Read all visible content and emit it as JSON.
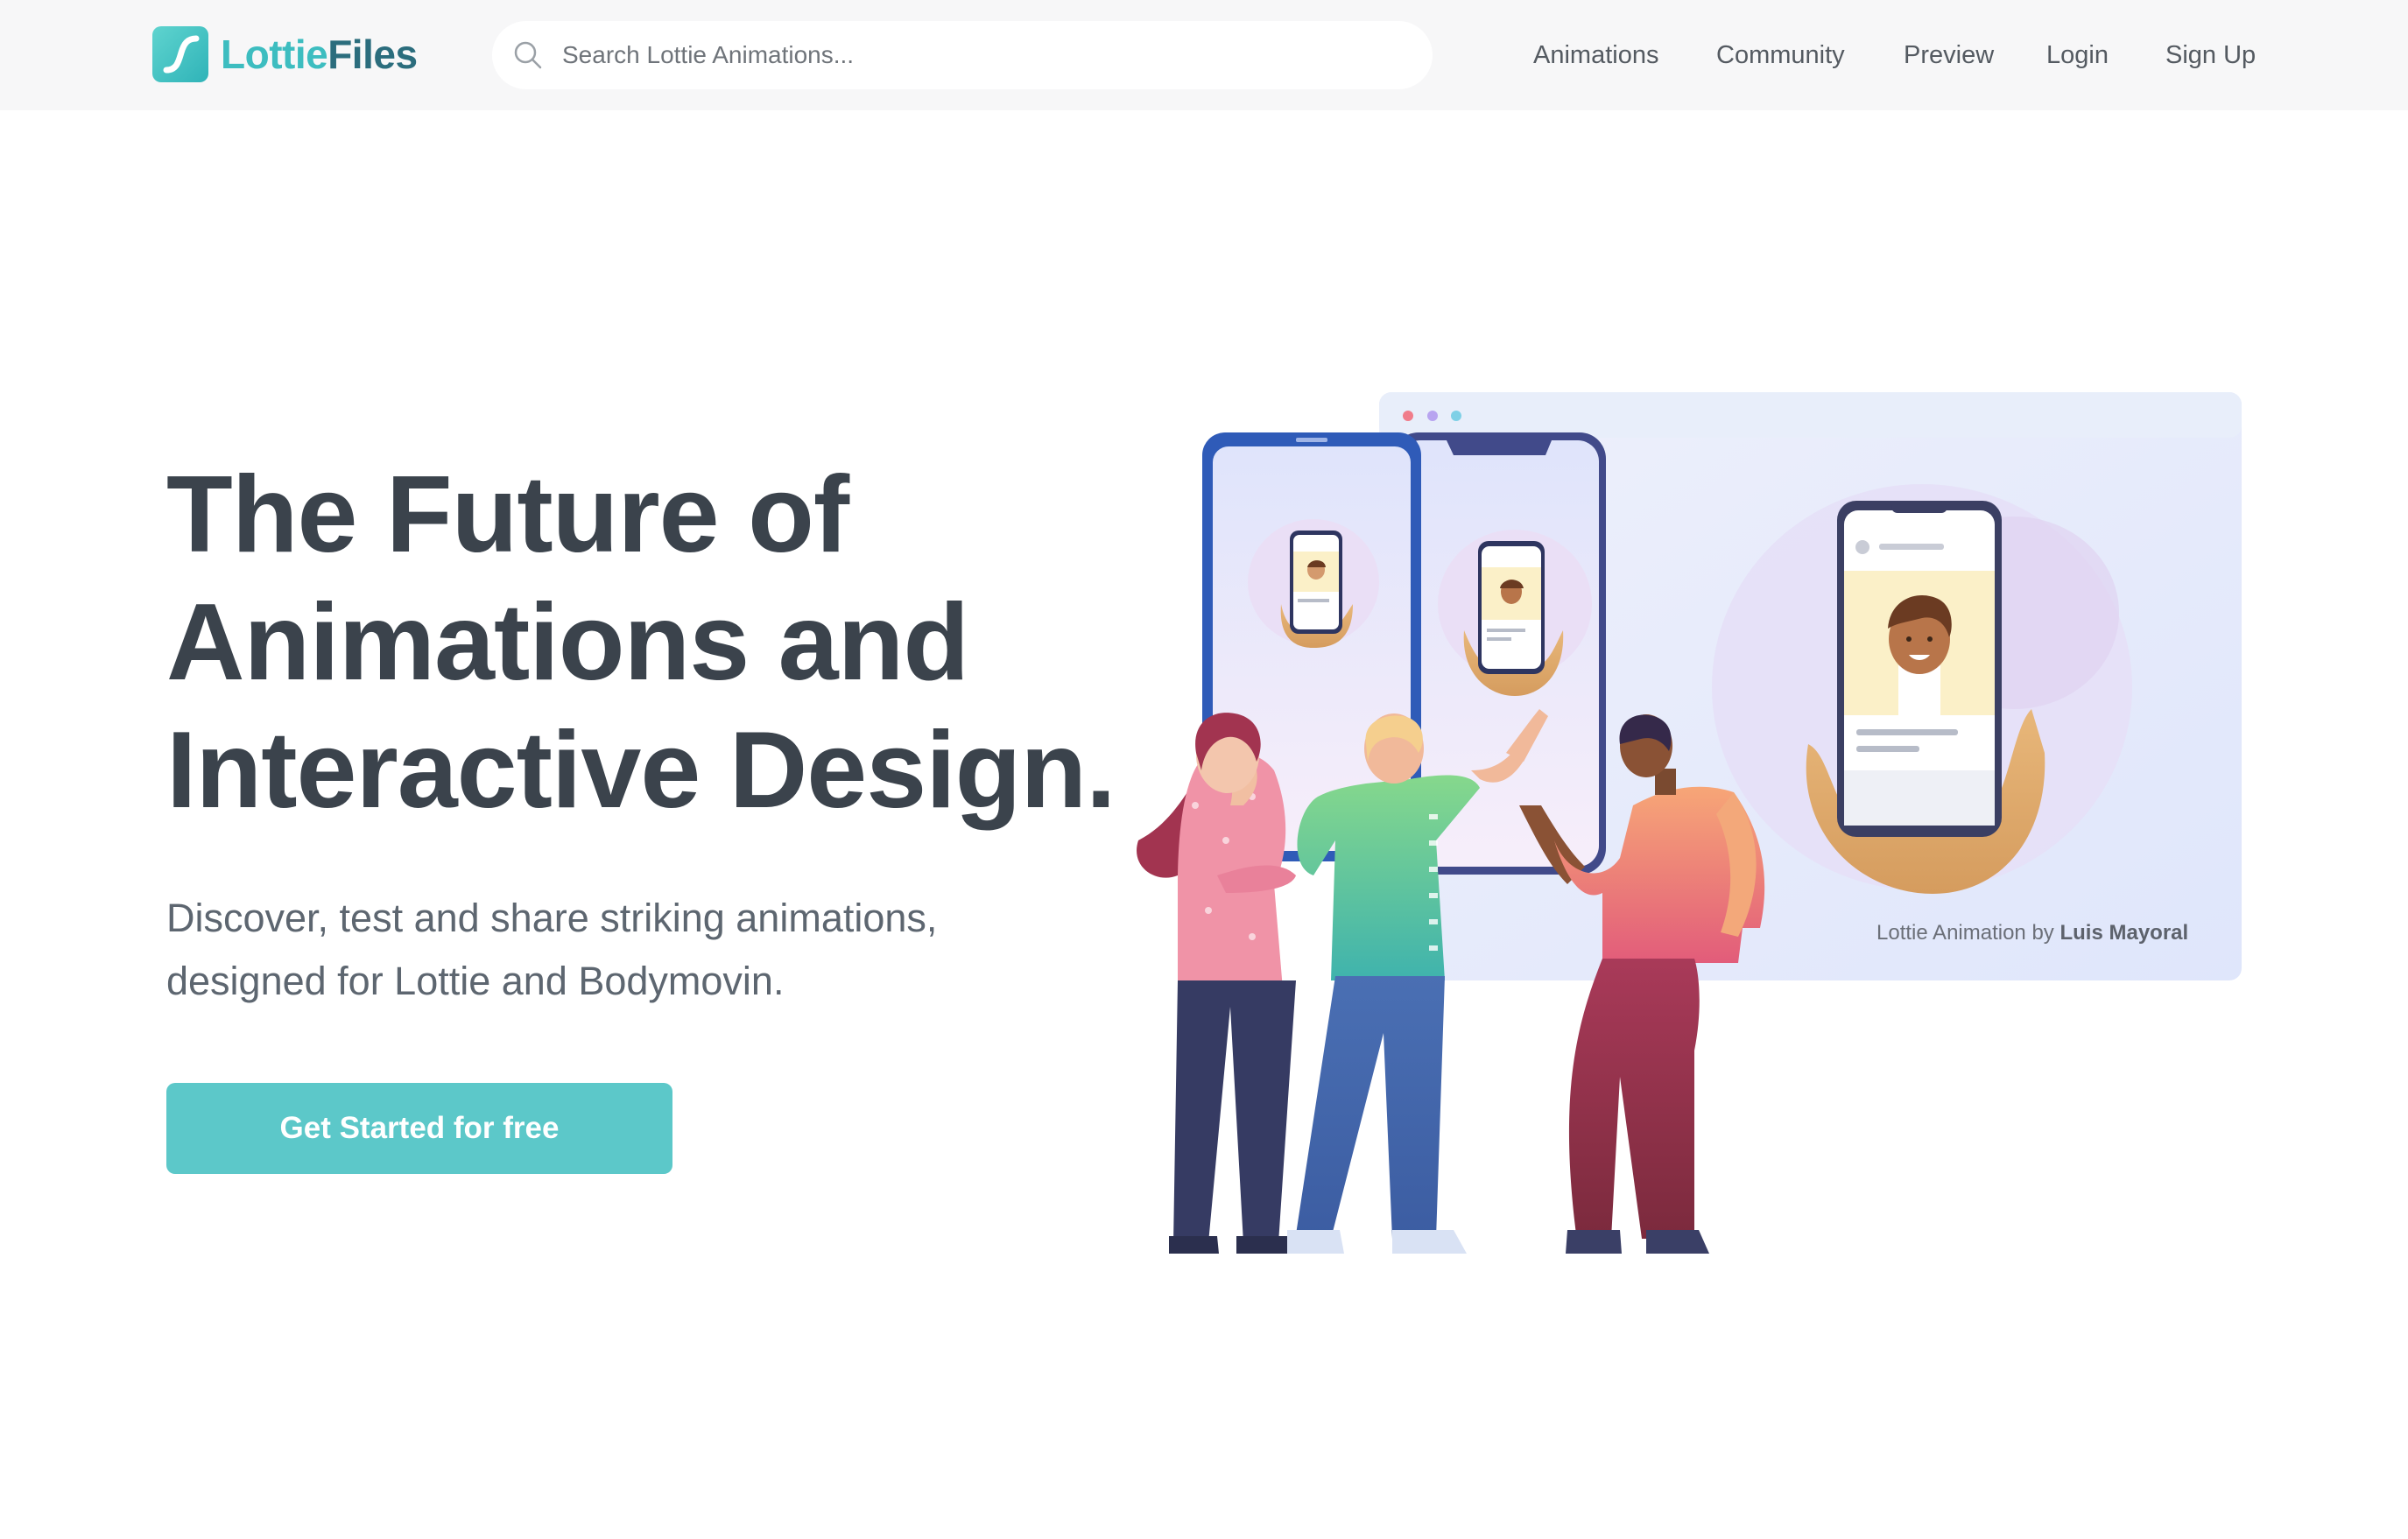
{
  "brand": {
    "name_part1": "Lottie",
    "name_part2": "Files",
    "icon": "lottiefiles-logo-icon",
    "colors": {
      "teal": "#3dbdc0",
      "dark_teal": "#2b6d7d"
    }
  },
  "search": {
    "placeholder": "Search Lottie Animations...",
    "value": "",
    "icon": "search-icon"
  },
  "nav": {
    "items": [
      {
        "label": "Animations"
      },
      {
        "label": "Community"
      },
      {
        "label": "Preview"
      },
      {
        "label": "Login"
      },
      {
        "label": "Sign Up"
      }
    ]
  },
  "hero": {
    "title_lines": [
      "The Future of",
      "Animations and",
      "Interactive Design."
    ],
    "subtitle_lines": [
      "Discover, test and share striking animations,",
      "designed for Lottie and Bodymovin."
    ],
    "cta_label": "Get Started for free",
    "cta_color": "#5cc8c9"
  },
  "illustration": {
    "credit_prefix": "Lottie Animation by",
    "credit_author": "Luis Mayoral"
  }
}
